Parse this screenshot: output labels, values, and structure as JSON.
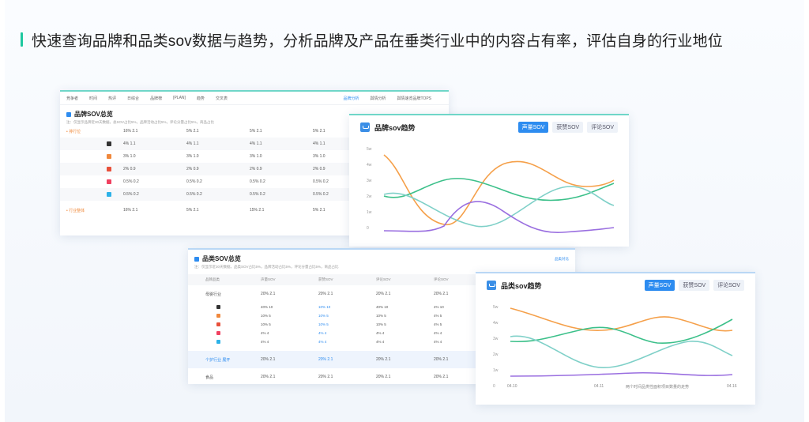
{
  "headline": "快速查询品牌和品类sov数据与趋势，分析品牌及产品在垂类行业中的内容占有率，评估自身的行业地位",
  "colors": {
    "accent": "#1ec8a0",
    "primary": "#2d8cf0",
    "orange": "#f5a04a",
    "green": "#3cc08a",
    "teal": "#7fd0c8",
    "purple": "#9a6fe0"
  },
  "brand_card": {
    "nav_items": [
      "竞争者",
      "时间",
      "热评",
      "日综合",
      "品牌榜",
      "[PLAN]",
      "趋势",
      "交叉表"
    ],
    "nav_right": [
      "品牌分析",
      "舆情分析",
      "舆情速览品牌TOPS"
    ],
    "title": "品牌SOV总览",
    "note": "注：仅显示品牌近30天数据，总SOV占比5%，品牌活动占比5%，评论分量占比5%，商品占比",
    "left_label": "• 排行位",
    "rows": [
      {
        "icon": "#333333",
        "cells": [
          "4% 1.1",
          "4% 1.1",
          "4% 1.1",
          "4% 1.1"
        ]
      },
      {
        "icon": "#f0883c",
        "cells": [
          "3% 1.0",
          "3% 1.0",
          "3% 1.0",
          "3% 1.0"
        ]
      },
      {
        "icon": "#e8503a",
        "cells": [
          "2% 0.9",
          "2% 0.9",
          "2% 0.9",
          "2% 0.9"
        ]
      },
      {
        "icon": "#f04060",
        "cells": [
          "0.5% 0.2",
          "0.5% 0.2",
          "0.5% 0.2",
          "0.5% 0.2"
        ]
      },
      {
        "icon": "#2db2e8",
        "cells": [
          "0.5% 0.2",
          "0.5% 0.2",
          "0.5% 0.2",
          "0.5% 0.2"
        ]
      }
    ],
    "top_summary": [
      "16% 2.1",
      "5% 2.1",
      "5% 2.1",
      "5% 2.1"
    ],
    "bottom_label": "• 行业整体",
    "bottom_summary": [
      "16% 2.1",
      "5% 2.1",
      "15% 2.1",
      "5% 2.1"
    ]
  },
  "brand_trend": {
    "title": "品牌sov趋势",
    "tabs": [
      "声量SOV",
      "获赞SOV",
      "评论SOV"
    ],
    "active_tab": 0,
    "y_ticks": [
      "5w",
      "4w",
      "3w",
      "2w",
      "1w",
      "0"
    ]
  },
  "cat_card": {
    "title": "品类SOV总览",
    "note": "注：仅显示近30天数据，品类SOV占比5%，品牌活动占比5%，评论分量占比5%，商品占比",
    "right_control": "品类对比",
    "headers": [
      "品牌品类",
      "声量SOV",
      "获赞SOV",
      "评论SOV",
      "评论SOV"
    ],
    "group_label": "母婴行业",
    "group_summary": [
      "20% 2.1",
      "20% 2.1",
      "20% 2.1",
      "20% 2.1"
    ],
    "rows": [
      {
        "icon": "#333333",
        "cells": [
          "40% 10",
          "10% 10",
          "40% 10",
          "4% 10"
        ]
      },
      {
        "icon": "#f0883c",
        "cells": [
          "10% 5",
          "10% 5",
          "10% 5",
          "4% 5"
        ]
      },
      {
        "icon": "#e8503a",
        "cells": [
          "10% 5",
          "10% 5",
          "10% 5",
          "4% 5"
        ]
      },
      {
        "icon": "#f04060",
        "cells": [
          "4% 4",
          "4% 4",
          "4% 4",
          "4% 4"
        ]
      },
      {
        "icon": "#2db2e8",
        "cells": [
          "4% 4",
          "4% 4",
          "4% 4",
          "4% 4"
        ]
      }
    ],
    "highlight_label": "个护行业  展开",
    "highlight_summary": [
      "20% 2.1",
      "20% 2.1",
      "20% 2.1",
      "20% 2.1"
    ],
    "bottom_label": "食品",
    "bottom_summary": [
      "20% 2.1",
      "20% 2.1",
      "20% 2.1",
      "20% 2.1"
    ]
  },
  "cat_trend": {
    "title": "品类sov趋势",
    "tabs": [
      "声量SOV",
      "获赞SOV",
      "评论SOV"
    ],
    "active_tab": 0,
    "y_ticks": [
      "5w",
      "4w",
      "3w",
      "2w",
      "1w",
      "0"
    ],
    "x_ticks": [
      "04.10",
      "04.11",
      "04.16"
    ],
    "x_note": "两个时间品类性面积项目数量的走势"
  }
}
